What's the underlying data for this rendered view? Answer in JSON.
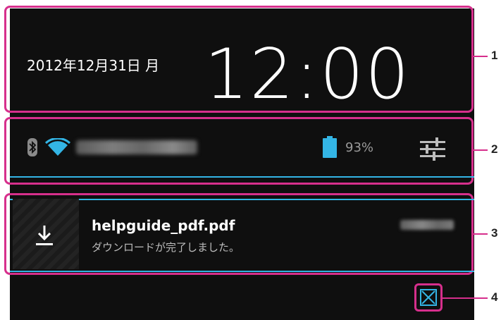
{
  "clock_panel": {
    "date": "2012年12月31日 月",
    "time": "12:00"
  },
  "status_panel": {
    "battery": "93%",
    "icons": [
      "bluetooth-icon",
      "wifi-icon",
      "battery-icon",
      "settings-icon"
    ]
  },
  "notification": {
    "title": "helpguide_pdf.pdf",
    "text": "ダウンロードが完了しました。",
    "icon": "download-icon"
  },
  "callouts": [
    "1",
    "2",
    "3",
    "4"
  ],
  "colors": {
    "accent": "#33b5e5",
    "callout": "#d62f8c",
    "panel_bg": "#0f0f0f"
  }
}
